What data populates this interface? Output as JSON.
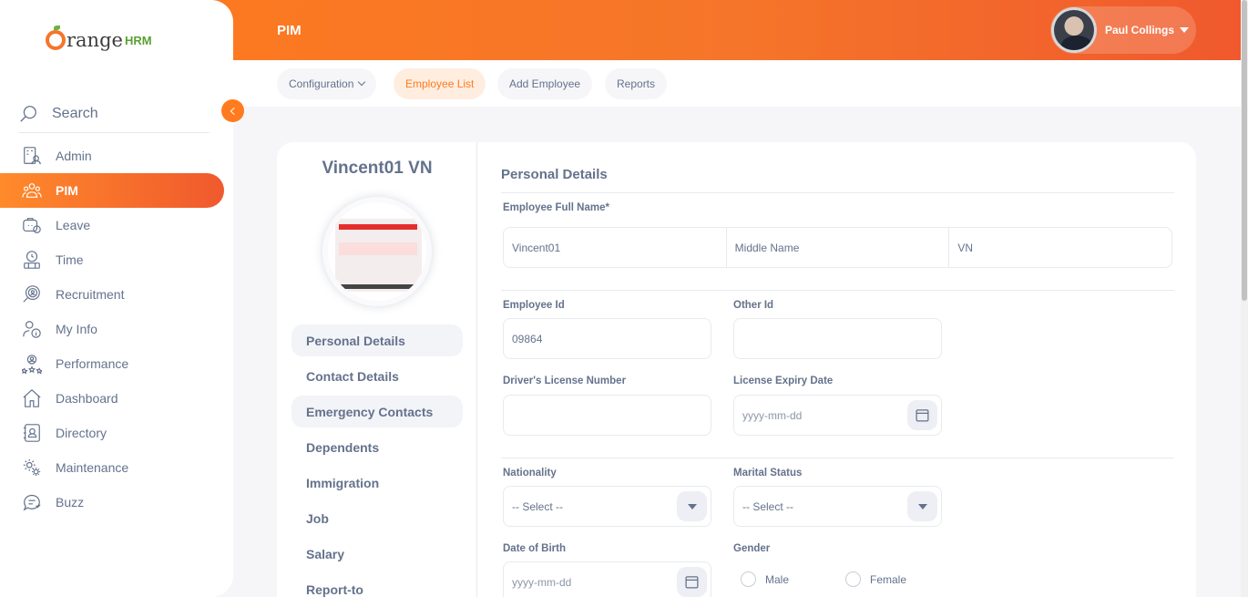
{
  "header": {
    "module_title": "PIM",
    "user_name": "Paul Collings"
  },
  "subnav": {
    "configuration": "Configuration",
    "employee_list": "Employee List",
    "add_employee": "Add Employee",
    "reports": "Reports"
  },
  "brand": {
    "logo_text": "range",
    "logo_suffix": "HRM",
    "accent_color": "#ff7b1d"
  },
  "sidebar": {
    "search_label": "Search",
    "items": [
      {
        "label": "Admin",
        "icon": "admin-icon"
      },
      {
        "label": "PIM",
        "icon": "pim-icon",
        "active": true
      },
      {
        "label": "Leave",
        "icon": "leave-icon"
      },
      {
        "label": "Time",
        "icon": "time-icon"
      },
      {
        "label": "Recruitment",
        "icon": "recruitment-icon"
      },
      {
        "label": "My Info",
        "icon": "my-info-icon"
      },
      {
        "label": "Performance",
        "icon": "performance-icon"
      },
      {
        "label": "Dashboard",
        "icon": "dashboard-icon"
      },
      {
        "label": "Directory",
        "icon": "directory-icon"
      },
      {
        "label": "Maintenance",
        "icon": "maintenance-icon"
      },
      {
        "label": "Buzz",
        "icon": "buzz-icon"
      }
    ]
  },
  "employee": {
    "display_name": "Vincent01 VN"
  },
  "tabs": [
    {
      "label": "Personal Details",
      "active": true
    },
    {
      "label": "Contact Details"
    },
    {
      "label": "Emergency Contacts",
      "hover": true
    },
    {
      "label": "Dependents"
    },
    {
      "label": "Immigration"
    },
    {
      "label": "Job"
    },
    {
      "label": "Salary"
    },
    {
      "label": "Report-to"
    }
  ],
  "form": {
    "section_title": "Personal Details",
    "full_name_label": "Employee Full Name*",
    "first_name_value": "Vincent01",
    "middle_name_placeholder": "Middle Name",
    "last_name_value": "VN",
    "employee_id_label": "Employee Id",
    "employee_id_value": "09864",
    "other_id_label": "Other Id",
    "other_id_value": "",
    "license_label": "Driver's License Number",
    "license_value": "",
    "license_expiry_label": "License Expiry Date",
    "license_expiry_placeholder": "yyyy-mm-dd",
    "nationality_label": "Nationality",
    "nationality_value": "-- Select --",
    "marital_label": "Marital Status",
    "marital_value": "-- Select --",
    "dob_label": "Date of Birth",
    "dob_placeholder": "yyyy-mm-dd",
    "gender_label": "Gender",
    "gender_options": [
      "Male",
      "Female"
    ]
  }
}
